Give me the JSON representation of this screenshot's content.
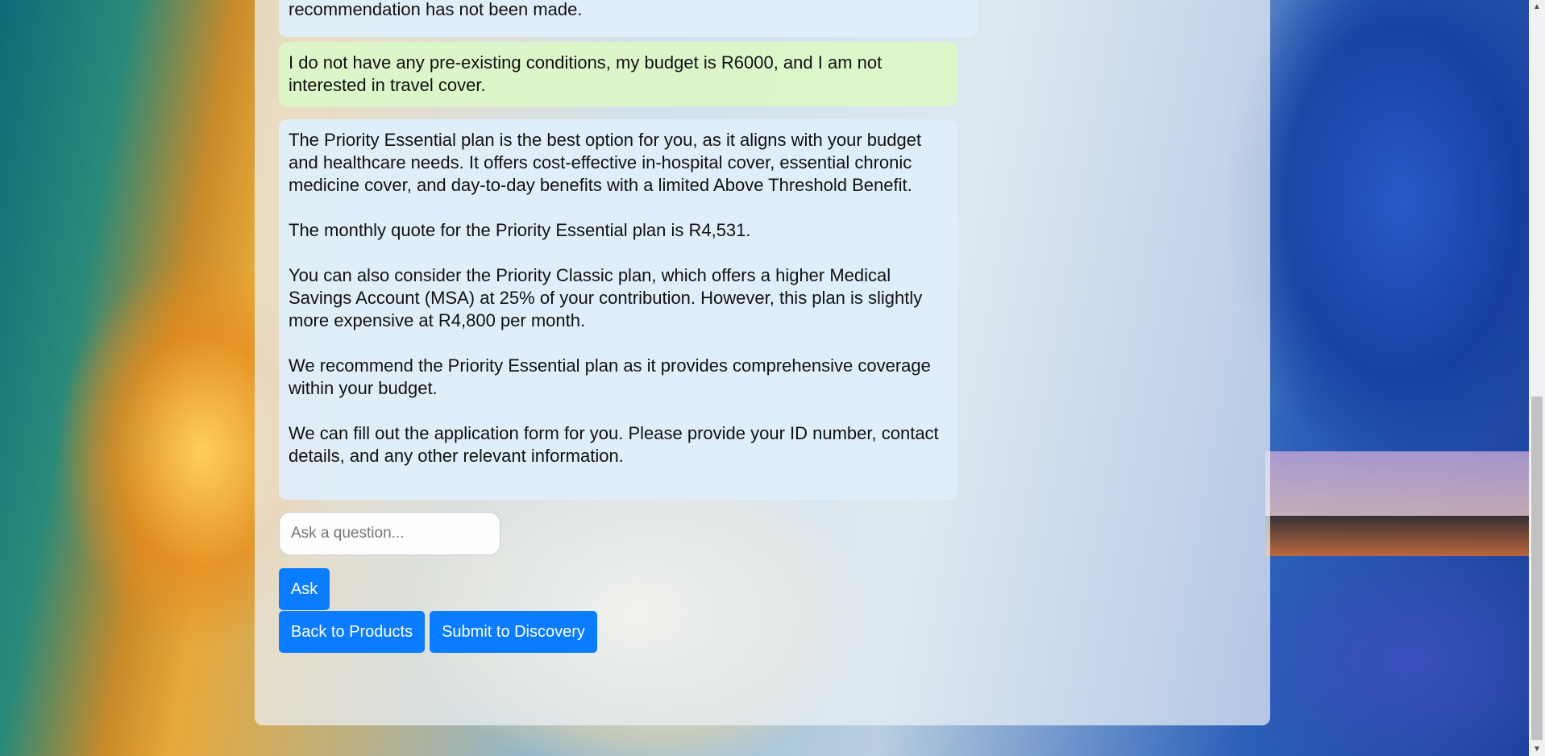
{
  "chat": {
    "messages": [
      {
        "role": "bot",
        "paragraphs": [
          "recommendation has not been made."
        ]
      },
      {
        "role": "user",
        "paragraphs": [
          "I do not have any pre-existing conditions, my budget is R6000, and I am not interested in travel cover."
        ]
      },
      {
        "role": "bot",
        "paragraphs": [
          "The Priority Essential plan is the best option for you, as it aligns with your budget and healthcare needs. It offers cost-effective in-hospital cover, essential chronic medicine cover, and day-to-day benefits with a limited Above Threshold Benefit.",
          "The monthly quote for the Priority Essential plan is R4,531.",
          "You can also consider the Priority Classic plan, which offers a higher Medical Savings Account (MSA) at 25% of your contribution. However, this plan is slightly more expensive at R4,800 per month.",
          "We recommend the Priority Essential plan as it provides comprehensive coverage within your budget.",
          "We can fill out the application form for you. Please provide your ID number, contact details, and any other relevant information."
        ]
      }
    ]
  },
  "input": {
    "placeholder": "Ask a question...",
    "value": ""
  },
  "buttons": {
    "ask": "Ask",
    "back": "Back to Products",
    "submit": "Submit to Discovery"
  },
  "scrollbar": {
    "up_icon": "▲",
    "down_icon": "▼"
  },
  "colors": {
    "button": "#0a7cff",
    "user_bubble": "#dcf7c8",
    "bot_bubble": "#dfeefb"
  }
}
